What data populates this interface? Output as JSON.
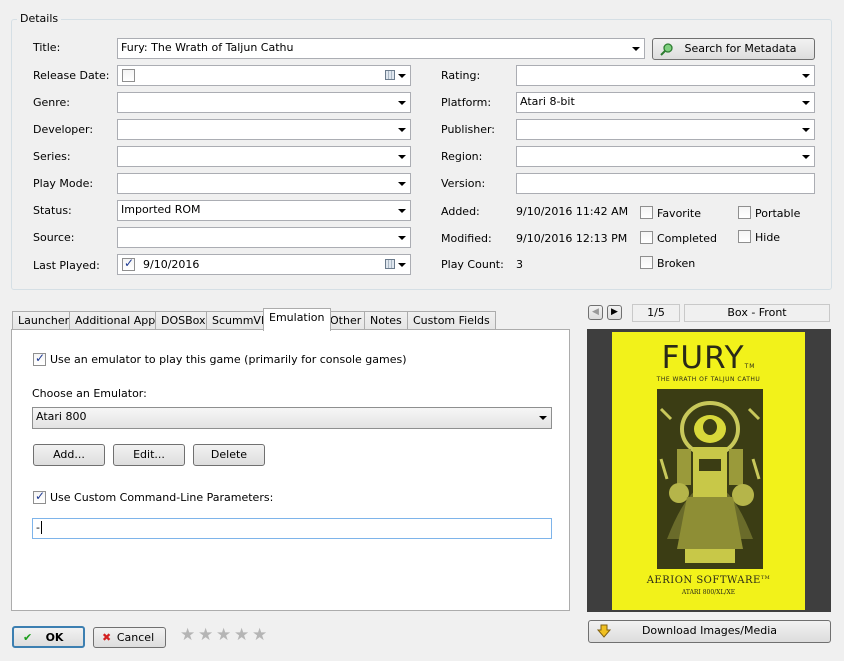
{
  "details": {
    "group_title": "Details",
    "title": {
      "label": "Title:",
      "value": "Fury: The Wrath of Taljun Cathu"
    },
    "search_metadata_label": "Search for Metadata",
    "release_date": {
      "label": "Release Date:",
      "checked": false,
      "value": ""
    },
    "genre": {
      "label": "Genre:",
      "value": ""
    },
    "developer": {
      "label": "Developer:",
      "value": ""
    },
    "series": {
      "label": "Series:",
      "value": ""
    },
    "play_mode": {
      "label": "Play Mode:",
      "value": ""
    },
    "status": {
      "label": "Status:",
      "value": "Imported ROM"
    },
    "source": {
      "label": "Source:",
      "value": ""
    },
    "last_played": {
      "label": "Last Played:",
      "checked": true,
      "value": "9/10/2016"
    },
    "rating": {
      "label": "Rating:",
      "value": ""
    },
    "platform": {
      "label": "Platform:",
      "value": "Atari 8-bit"
    },
    "publisher": {
      "label": "Publisher:",
      "value": ""
    },
    "region": {
      "label": "Region:",
      "value": ""
    },
    "version": {
      "label": "Version:",
      "value": ""
    },
    "added": {
      "label": "Added:",
      "value": "9/10/2016 11:42 AM"
    },
    "modified": {
      "label": "Modified:",
      "value": "9/10/2016 12:13 PM"
    },
    "play_count": {
      "label": "Play Count:",
      "value": "3"
    },
    "flags": {
      "favorite": {
        "label": "Favorite",
        "checked": false
      },
      "completed": {
        "label": "Completed",
        "checked": false
      },
      "broken": {
        "label": "Broken",
        "checked": false
      },
      "portable": {
        "label": "Portable",
        "checked": false
      },
      "hide": {
        "label": "Hide",
        "checked": false
      }
    }
  },
  "tabs": [
    {
      "label": "Launcher"
    },
    {
      "label": "Additional Apps"
    },
    {
      "label": "DOSBox"
    },
    {
      "label": "ScummVM"
    },
    {
      "label": "Emulation",
      "active": true
    },
    {
      "label": "Other"
    },
    {
      "label": "Notes"
    },
    {
      "label": "Custom Fields"
    }
  ],
  "emulation": {
    "use_emulator_label": "Use an emulator to play this game (primarily for console games)",
    "use_emulator_checked": true,
    "choose_label": "Choose an Emulator:",
    "emulator_value": "Atari 800",
    "add_label": "Add...",
    "edit_label": "Edit...",
    "delete_label": "Delete",
    "custom_params_label": "Use Custom Command-Line Parameters:",
    "custom_params_checked": true,
    "params_value": "-"
  },
  "image_viewer": {
    "counter": "1/5",
    "image_type": "Box - Front",
    "download_label": "Download Images/Media",
    "cover": {
      "title": "FURY",
      "tm": "TM",
      "subtitle": "THE WRATH OF TALJUN CATHU",
      "publisher": "AERION SOFTWARE",
      "publisher_tm": "TM",
      "systems": "ATARI 800/XL/XE",
      "bg_color": "#f2f21a"
    }
  },
  "footer": {
    "ok_label": "OK",
    "cancel_label": "Cancel",
    "rating_stars": 0,
    "max_stars": 5
  }
}
